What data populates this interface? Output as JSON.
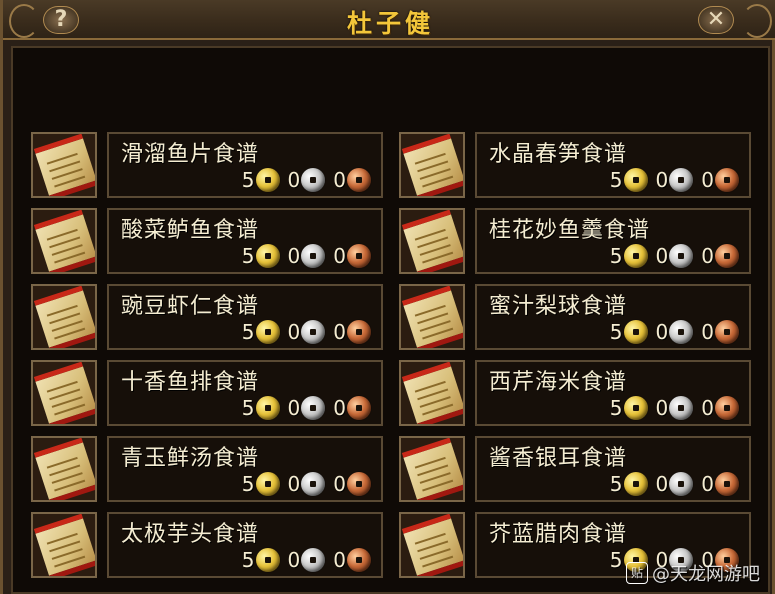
{
  "window": {
    "title": "杜子健",
    "help_label": "?",
    "close_label": "✕"
  },
  "coin_colors": {
    "gold": "#e6c23a",
    "silver": "#c8c8c8",
    "copper": "#c86a38"
  },
  "recipes": [
    {
      "name": "滑溜鱼片食谱",
      "gold": "5",
      "silver": "0",
      "copper": "0"
    },
    {
      "name": "水晶春笋食谱",
      "gold": "5",
      "silver": "0",
      "copper": "0"
    },
    {
      "name": "酸菜鲈鱼食谱",
      "gold": "5",
      "silver": "0",
      "copper": "0"
    },
    {
      "name": "桂花妙鱼羹食谱",
      "gold": "5",
      "silver": "0",
      "copper": "0"
    },
    {
      "name": "豌豆虾仁食谱",
      "gold": "5",
      "silver": "0",
      "copper": "0"
    },
    {
      "name": "蜜汁梨球食谱",
      "gold": "5",
      "silver": "0",
      "copper": "0"
    },
    {
      "name": "十香鱼排食谱",
      "gold": "5",
      "silver": "0",
      "copper": "0"
    },
    {
      "name": "西芹海米食谱",
      "gold": "5",
      "silver": "0",
      "copper": "0"
    },
    {
      "name": "青玉鲜汤食谱",
      "gold": "5",
      "silver": "0",
      "copper": "0"
    },
    {
      "name": "酱香银耳食谱",
      "gold": "5",
      "silver": "0",
      "copper": "0"
    },
    {
      "name": "太极芋头食谱",
      "gold": "5",
      "silver": "0",
      "copper": "0"
    },
    {
      "name": "芥蓝腊肉食谱",
      "gold": "5",
      "silver": "0",
      "copper": "0"
    }
  ],
  "watermark": {
    "badge": "贴",
    "text": "@天龙网游吧"
  }
}
